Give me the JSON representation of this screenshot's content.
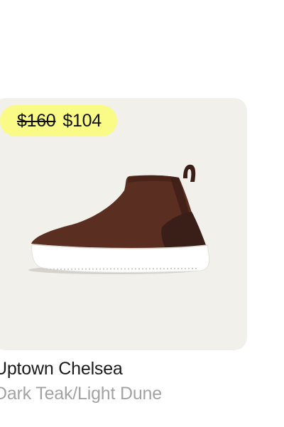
{
  "product": {
    "price_original": "$160",
    "price_sale": "$104",
    "name": "Uptown Chelsea",
    "variant": "Dark Teak/Light Dune",
    "image_icon": "shoe-image"
  },
  "colors": {
    "card_bg": "#f2f0ea",
    "badge_bg": "#fafb86",
    "shoe_upper": "#5a2f22",
    "sole": "#ffffff"
  }
}
